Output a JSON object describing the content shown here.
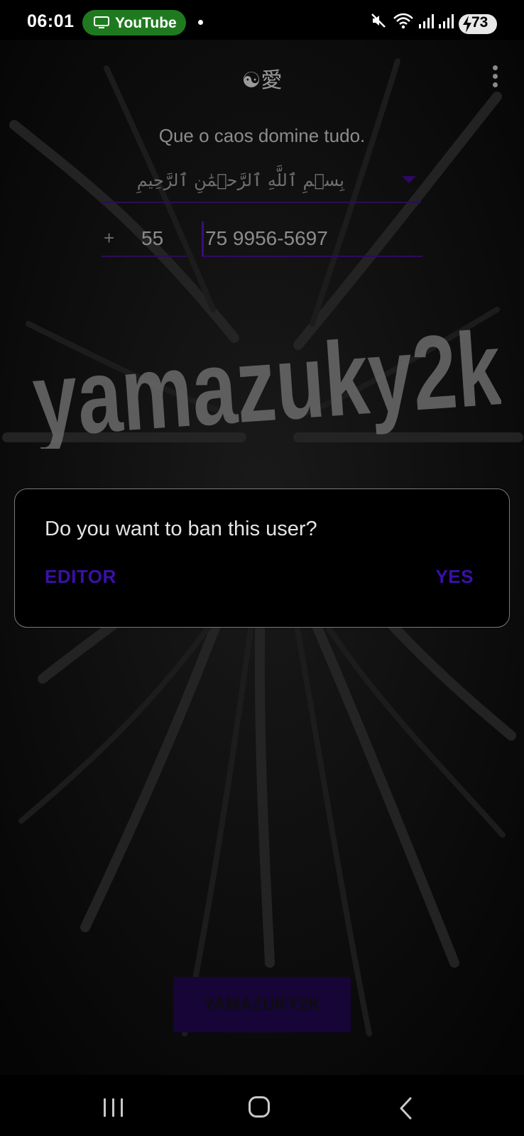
{
  "status_bar": {
    "time": "06:01",
    "app_pill_label": "YouTube",
    "battery_level": "73",
    "icons": [
      "tv-icon",
      "mute-icon",
      "wifi-icon",
      "signal-icon",
      "signal-icon",
      "battery-charging-icon"
    ]
  },
  "app": {
    "title": "☯愛",
    "tagline": "Que o caos domine tudo.",
    "country_select": {
      "value": "بِسۡمِ ٱللَّهِ ٱلرَّحۡمَٰنِ ٱلرَّحِيمِ",
      "icon": "dropdown-arrow-icon"
    },
    "phone": {
      "plus": "+",
      "country_code": "55",
      "number": "75 9956-5697"
    },
    "logo_text": "yamazuky2k",
    "main_button_label": "YAMAZUKY2K"
  },
  "dialog": {
    "message": "Do you want to ban this user?",
    "left_button": "EDITOR",
    "right_button": "YES"
  },
  "nav_bar": {
    "icons": [
      "recents-icon",
      "home-icon",
      "back-icon"
    ]
  },
  "colors": {
    "accent": "#3a10a8",
    "button_bg": "#160536",
    "status_pill": "#1f7a1f"
  }
}
